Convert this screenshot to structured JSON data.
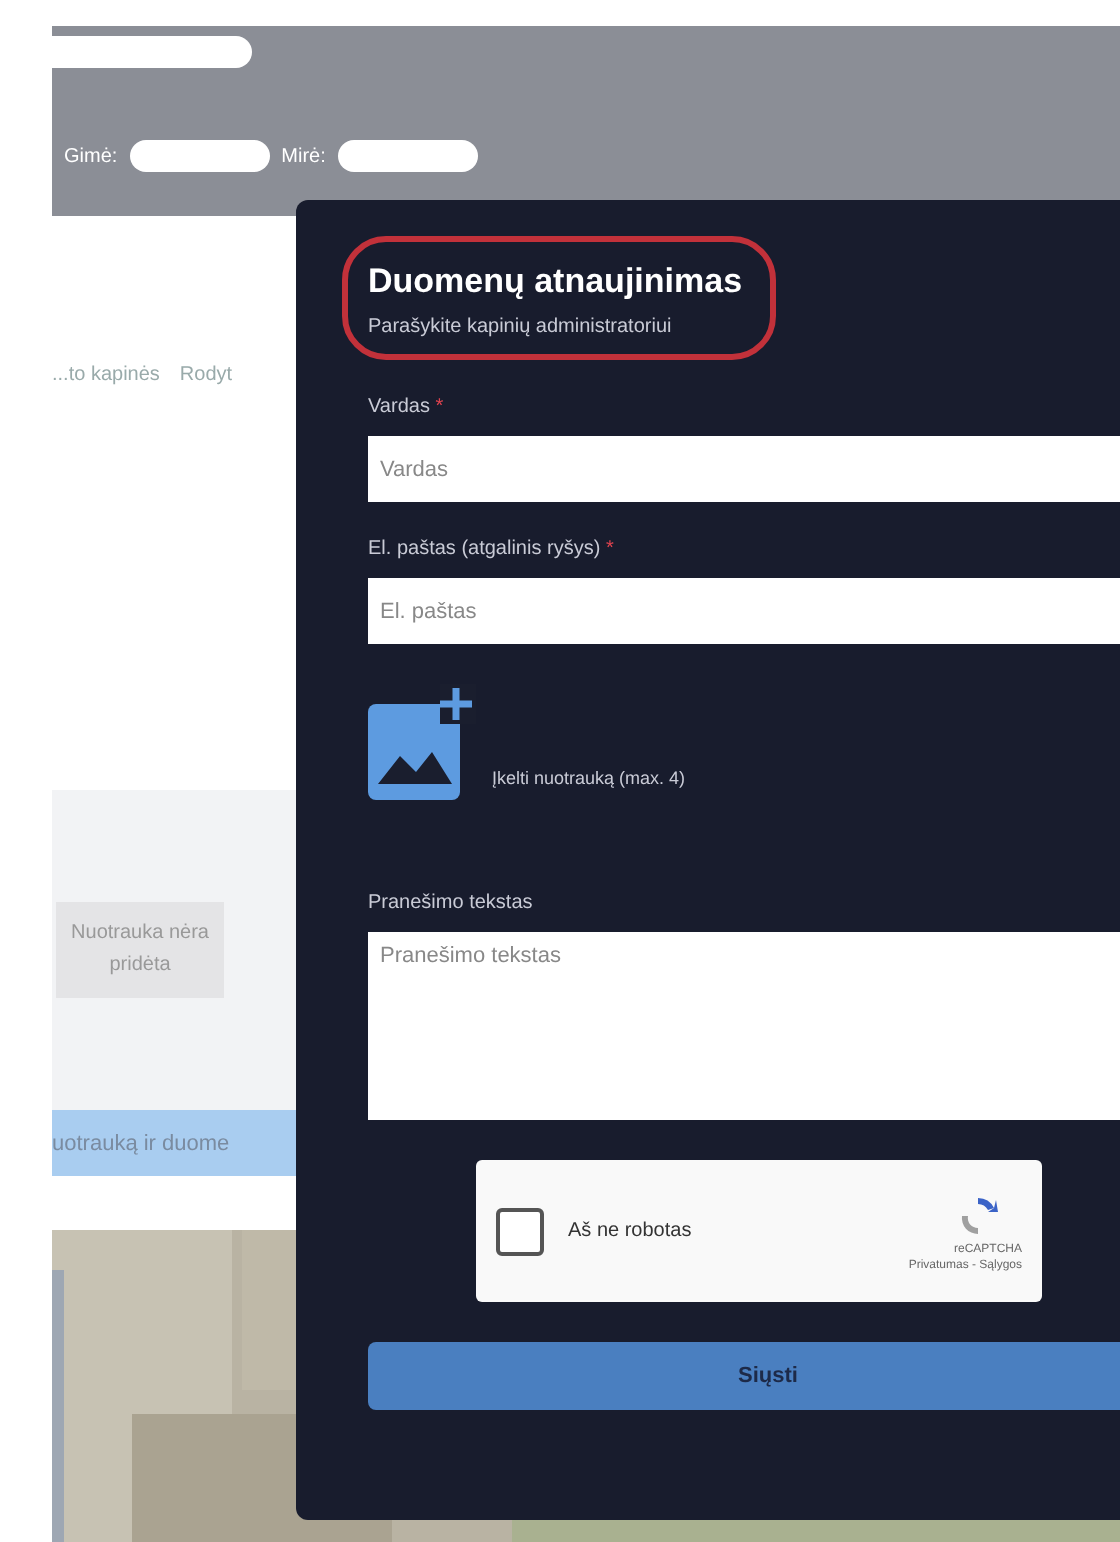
{
  "header": {
    "born_label": "Gimė:",
    "died_label": "Mirė:"
  },
  "page": {
    "link_text": "...to kapinės",
    "link_button": "Rodyt",
    "photo_placeholder": "Nuotrauka nėra pridėta",
    "blue_bar": "uotrauką ir duome"
  },
  "modal": {
    "title": "Duomenų atnaujinimas",
    "subtitle": "Parašykite kapinių administratoriui",
    "fields": [
      {
        "kind": "input",
        "label": "Vardas",
        "required_mark": "*",
        "placeholder": "Vardas"
      },
      {
        "kind": "input",
        "label": "El. paštas (atgalinis ryšys)",
        "required_mark": "*",
        "placeholder": "El. paštas"
      },
      {
        "kind": "upload",
        "label": "Įkelti nuotrauką (max. 4)"
      },
      {
        "kind": "textarea",
        "label": "Pranešimo tekstas",
        "placeholder": "Pranešimo tekstas"
      }
    ],
    "captcha": {
      "label": "Aš ne robotas",
      "checked": false,
      "brand": "reCAPTCHA",
      "links": "Privatumas - Sąlygos"
    },
    "submit": "Siųsti"
  }
}
